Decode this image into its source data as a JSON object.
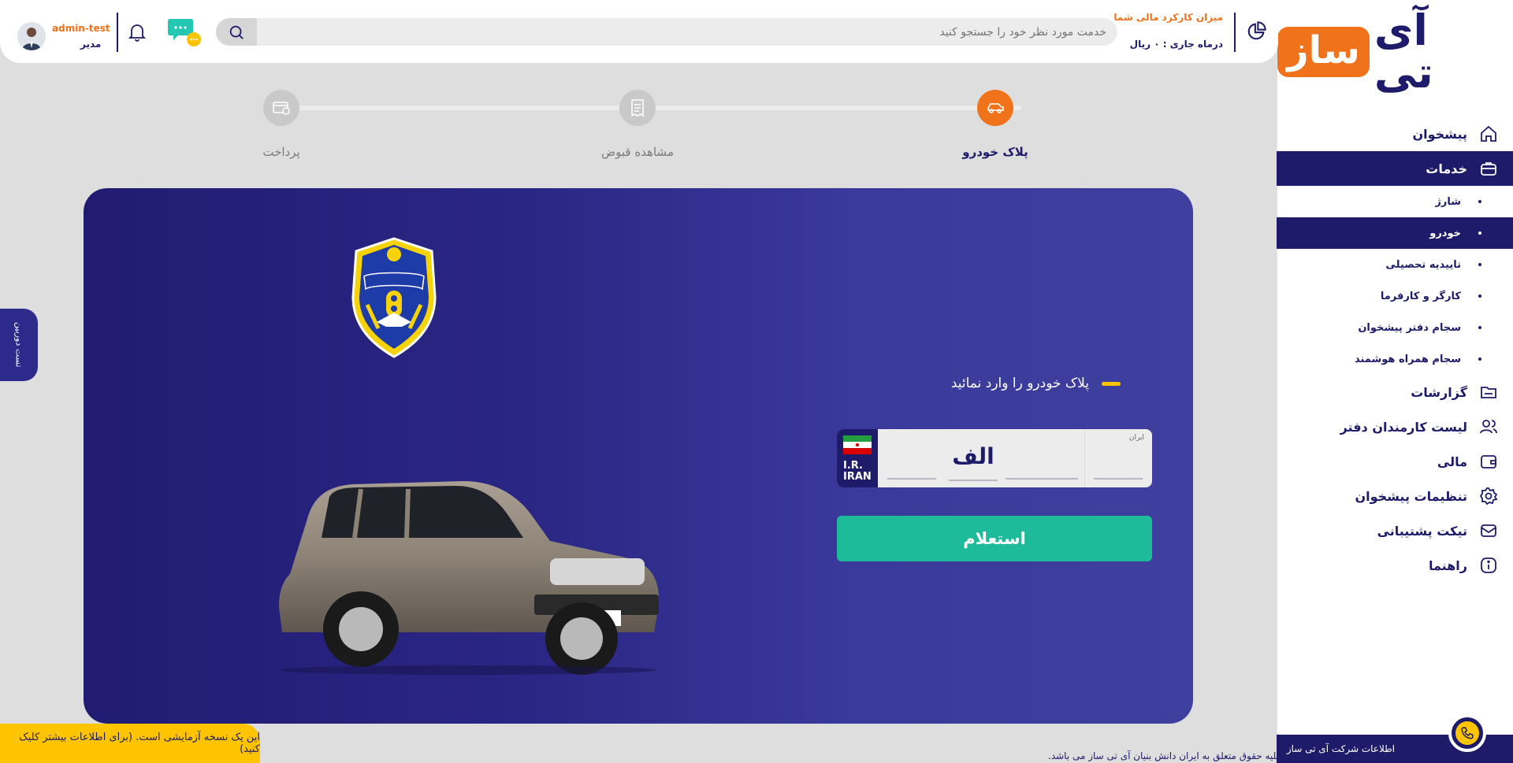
{
  "brand": {
    "logo_main": "آی تی",
    "logo_accent": "ساز"
  },
  "sidebar": {
    "items": [
      {
        "label": "پیشخوان",
        "icon": "home-icon"
      },
      {
        "label": "خدمات",
        "icon": "briefcase-icon",
        "active": true
      },
      {
        "label": "گزارشات",
        "icon": "folder-icon"
      },
      {
        "label": "لیست کارمندان دفتر",
        "icon": "users-icon"
      },
      {
        "label": "مالی",
        "icon": "wallet-icon"
      },
      {
        "label": "تنظیمات پیشخوان",
        "icon": "gear-icon"
      },
      {
        "label": "تیکت پشتیبانی",
        "icon": "mail-icon"
      },
      {
        "label": "راهنما",
        "icon": "info-icon"
      }
    ],
    "services_sub": [
      {
        "label": "شارژ"
      },
      {
        "label": "خودرو",
        "active": true
      },
      {
        "label": "تاییدیه تحصیلی"
      },
      {
        "label": "کارگر و کارفرما"
      },
      {
        "label": "سجام دفتر پیشخوان"
      },
      {
        "label": "سجام همراه هوشمند"
      }
    ],
    "footer": "اطلاعات شرکت آی تی ساز"
  },
  "header": {
    "finance_title": "میزان کارکرد مالی شما",
    "finance_value": "درماه جاری : ۰ ریال",
    "search_placeholder": "خدمت مورد نظر خود را جستجو کنید",
    "user_name": "admin-test",
    "user_role": "مدیر"
  },
  "stepper": {
    "steps": [
      {
        "label": "پلاک خودرو",
        "active": true
      },
      {
        "label": "مشاهده قبوض",
        "active": false
      },
      {
        "label": "پرداخت",
        "active": false
      }
    ]
  },
  "main": {
    "prompt": "پلاک خودرو را وارد نمائید",
    "plate": {
      "country_code": "I.R.",
      "country": "IRAN",
      "letter": "الف",
      "iran_label": "ایران"
    },
    "inquiry_button": "استعلام"
  },
  "side_tab": "تست دوربین",
  "trial_notice": "این یک نسخه آزمایشی است. (برای اطلاعات بیشتر کلیک کنید)",
  "copyright": "کلیه حقوق متعلق به ایران دانش بنیان آی تی ساز می باشد.",
  "colors": {
    "navy": "#1e1b6a",
    "orange": "#f0721b",
    "teal": "#1ebb9a",
    "yellow": "#ffc400"
  }
}
